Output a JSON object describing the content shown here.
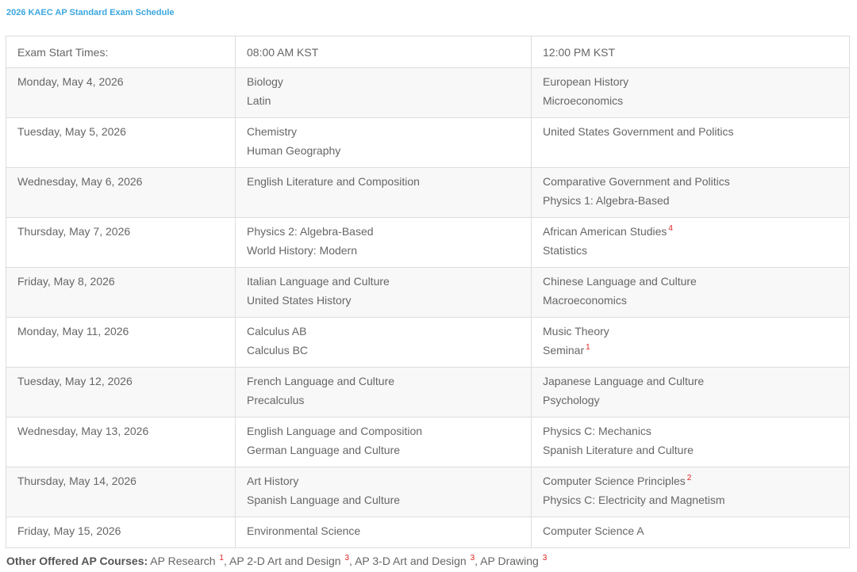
{
  "page_title": "2026 KAEC AP Standard Exam Schedule",
  "table": {
    "header": {
      "label": "Exam Start Times:",
      "morning": "08:00 AM KST",
      "afternoon": "12:00 PM KST"
    },
    "rows": [
      {
        "date": "Monday, May 4, 2026",
        "morning": [
          {
            "name": "Biology"
          },
          {
            "name": "Latin"
          }
        ],
        "afternoon": [
          {
            "name": "European History"
          },
          {
            "name": "Microeconomics"
          }
        ]
      },
      {
        "date": "Tuesday, May 5, 2026",
        "morning": [
          {
            "name": "Chemistry"
          },
          {
            "name": "Human Geography"
          }
        ],
        "afternoon": [
          {
            "name": "United States Government and Politics"
          }
        ]
      },
      {
        "date": "Wednesday, May 6, 2026",
        "morning": [
          {
            "name": "English Literature and Composition"
          }
        ],
        "afternoon": [
          {
            "name": "Comparative Government and Politics"
          },
          {
            "name": "Physics 1: Algebra-Based"
          }
        ]
      },
      {
        "date": "Thursday, May 7, 2026",
        "morning": [
          {
            "name": "Physics 2: Algebra-Based"
          },
          {
            "name": "World History: Modern"
          }
        ],
        "afternoon": [
          {
            "name": "African American Studies",
            "note": "4"
          },
          {
            "name": "Statistics"
          }
        ]
      },
      {
        "date": "Friday, May 8, 2026",
        "morning": [
          {
            "name": "Italian Language and Culture"
          },
          {
            "name": "United States History"
          }
        ],
        "afternoon": [
          {
            "name": "Chinese Language and Culture"
          },
          {
            "name": "Macroeconomics"
          }
        ]
      },
      {
        "date": "Monday, May 11, 2026",
        "morning": [
          {
            "name": "Calculus AB"
          },
          {
            "name": "Calculus BC"
          }
        ],
        "afternoon": [
          {
            "name": "Music Theory"
          },
          {
            "name": "Seminar",
            "note": "1"
          }
        ]
      },
      {
        "date": "Tuesday, May 12, 2026",
        "morning": [
          {
            "name": "French Language and Culture"
          },
          {
            "name": "Precalculus"
          }
        ],
        "afternoon": [
          {
            "name": "Japanese Language and Culture"
          },
          {
            "name": "Psychology"
          }
        ]
      },
      {
        "date": "Wednesday, May 13, 2026",
        "morning": [
          {
            "name": "English Language and Composition"
          },
          {
            "name": "German Language and Culture"
          }
        ],
        "afternoon": [
          {
            "name": "Physics C: Mechanics"
          },
          {
            "name": "Spanish Literature and Culture"
          }
        ]
      },
      {
        "date": "Thursday, May 14, 2026",
        "morning": [
          {
            "name": "Art History"
          },
          {
            "name": "Spanish Language and Culture"
          }
        ],
        "afternoon": [
          {
            "name": "Computer Science Principles",
            "note": "2"
          },
          {
            "name": "Physics C: Electricity and Magnetism"
          }
        ]
      },
      {
        "date": "Friday, May 15, 2026",
        "morning": [
          {
            "name": "Environmental Science"
          }
        ],
        "afternoon": [
          {
            "name": "Computer Science A"
          }
        ]
      }
    ]
  },
  "footer": {
    "label": "Other Offered AP Courses:",
    "courses": [
      {
        "name": "AP Research",
        "note": "1"
      },
      {
        "name": "AP 2-D Art and Design",
        "note": "3"
      },
      {
        "name": "AP 3-D Art and Design",
        "note": "3"
      },
      {
        "name": "AP Drawing",
        "note": "3"
      }
    ]
  },
  "colors": {
    "title": "#3ba7df",
    "footnote_marker": "#e02020",
    "text": "#666666",
    "border": "#dddddd",
    "stripe": "#f8f8f8"
  }
}
